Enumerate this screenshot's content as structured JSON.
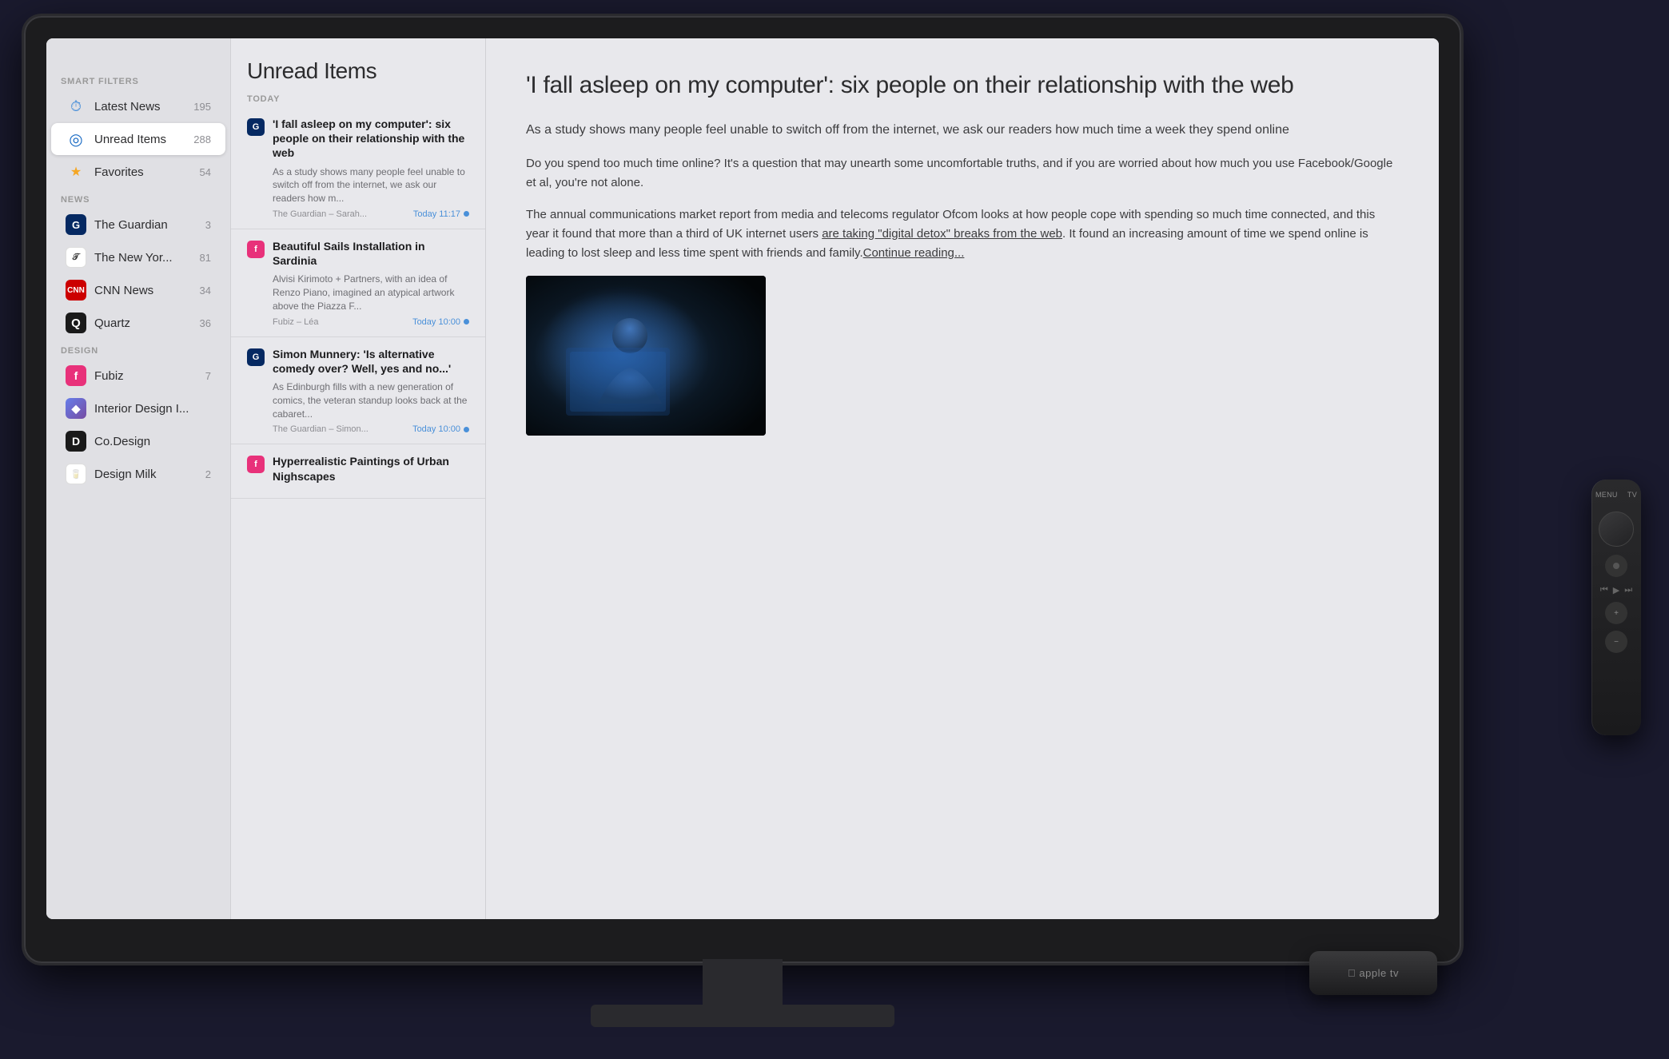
{
  "scene": {
    "background": "#1a1a2e"
  },
  "sidebar": {
    "smart_filters_label": "SMART FILTERS",
    "news_label": "NEWS",
    "design_label": "DESIGN",
    "items": [
      {
        "id": "latest-news",
        "label": "Latest News",
        "count": "195",
        "icon": "clock"
      },
      {
        "id": "unread-items",
        "label": "Unread Items",
        "count": "288",
        "icon": "circle",
        "active": true
      },
      {
        "id": "favorites",
        "label": "Favorites",
        "count": "54",
        "icon": "star"
      }
    ],
    "news_feeds": [
      {
        "id": "guardian",
        "label": "The Guardian",
        "count": "3",
        "icon": "G",
        "color": "#052962"
      },
      {
        "id": "nyt",
        "label": "The New Yor...",
        "count": "81",
        "icon": "𝒯",
        "color": "#fff",
        "textColor": "#333"
      },
      {
        "id": "cnn",
        "label": "CNN News",
        "count": "34",
        "icon": "CNN",
        "color": "#cc0000"
      },
      {
        "id": "quartz",
        "label": "Quartz",
        "count": "36",
        "icon": "Q",
        "color": "#1a1a1a"
      }
    ],
    "design_feeds": [
      {
        "id": "fubiz",
        "label": "Fubiz",
        "count": "7",
        "icon": "f",
        "color": "#e8317a"
      },
      {
        "id": "interior",
        "label": "Interior Design I...",
        "count": "",
        "icon": "◆",
        "color": "#764ba2"
      },
      {
        "id": "codesign",
        "label": "Co.Design",
        "count": "",
        "icon": "D",
        "color": "#1a1a1a"
      },
      {
        "id": "designmilk",
        "label": "Design Milk",
        "count": "2",
        "icon": "🥛",
        "color": "#fff",
        "textColor": "#555"
      }
    ]
  },
  "article_list": {
    "header": "Unread Items",
    "section_today": "TODAY",
    "articles": [
      {
        "id": "a1",
        "feed_icon": "G",
        "feed_color": "#052962",
        "title": "'I fall asleep on my computer': six people on their relationship with the web",
        "excerpt": "As a study shows many people feel unable to switch off from the internet, we ask our readers how m...",
        "source": "The Guardian – Sarah...",
        "time": "Today 11:17",
        "dot": true
      },
      {
        "id": "a2",
        "feed_icon": "f",
        "feed_color": "#e8317a",
        "title": "Beautiful Sails Installation in Sardinia",
        "excerpt": "Alvisi Kirimoto + Partners, with an idea of Renzo Piano, imagined an atypical artwork above the Piazza F...",
        "source": "Fubiz – Léa",
        "time": "Today 10:00",
        "dot": true
      },
      {
        "id": "a3",
        "feed_icon": "G",
        "feed_color": "#052962",
        "title": "Simon Munnery: 'Is alternative comedy over? Well, yes and no...'",
        "excerpt": "As Edinburgh fills with a new generation of comics, the veteran standup looks back at the cabaret...",
        "source": "The Guardian – Simon...",
        "time": "Today 10:00",
        "dot": true
      },
      {
        "id": "a4",
        "feed_icon": "f",
        "feed_color": "#e8317a",
        "title": "Hyperrealistic Paintings of Urban Nighscapes",
        "excerpt": "",
        "source": "",
        "time": "",
        "dot": false
      }
    ]
  },
  "article_content": {
    "title": "'I fall asleep on my computer': six people on their relationship with the web",
    "subtitle": "As a study shows many people feel unable to switch off from the internet, we ask our readers how much time a week they spend online",
    "paragraphs": [
      "Do you spend too much time online? It's a question that may unearth some uncomfortable truths, and if you are worried about how much you use Facebook/Google et al, you're not alone.",
      "The annual communications market report from media and telecoms regulator Ofcom looks at how people cope with spending so much time connected, and this year it found that more than a third of UK internet users are taking \"digital detox\" breaks from the web. It found an increasing amount of time we spend online is leading to lost sleep and less time spent with friends and family. Continue reading..."
    ]
  },
  "remote": {
    "menu_label": "MENU",
    "tv_label": "TV",
    "play_icon": "▶",
    "skip_back": "⏮",
    "skip_fwd": "⏭"
  },
  "appletv": {
    "label": "apple tv"
  }
}
